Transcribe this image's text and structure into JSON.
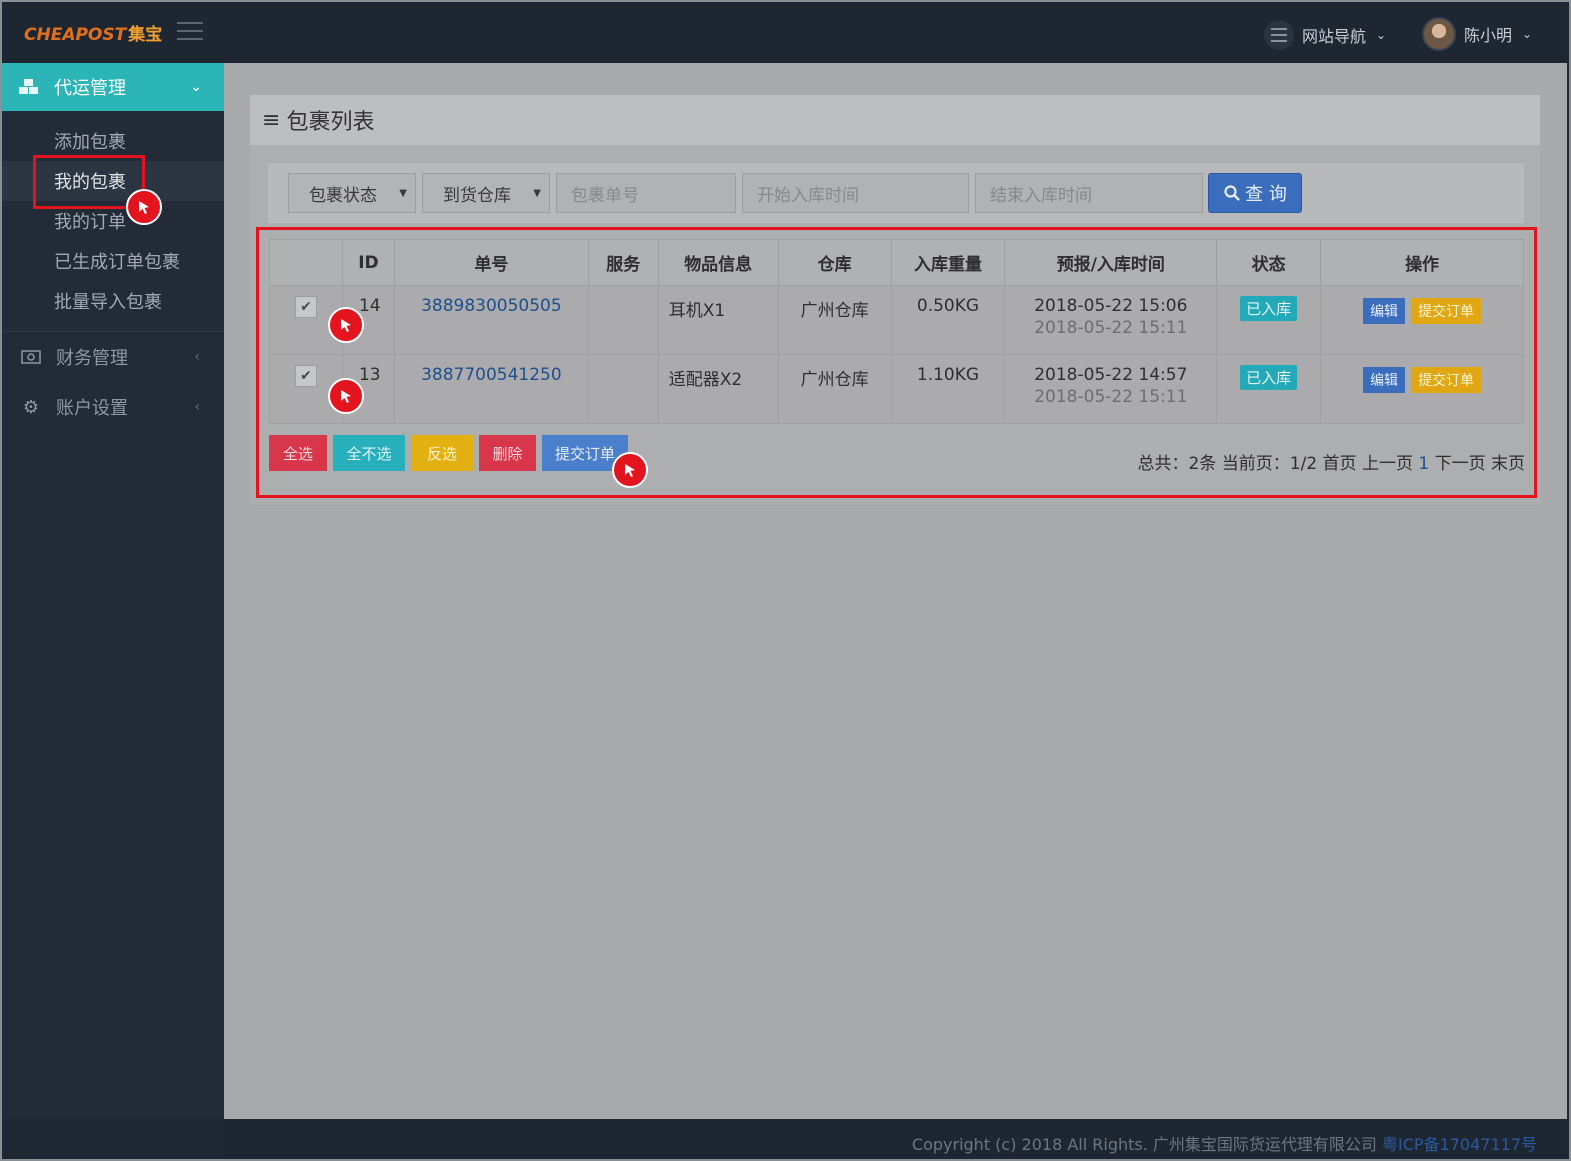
{
  "header": {
    "logo_en": "CHEAPOST",
    "logo_cn": "集宝",
    "nav_label": "网站导航",
    "user_name": "陈小明"
  },
  "sidebar": {
    "group_main": "代运管理",
    "items": [
      "添加包裹",
      "我的包裹",
      "我的订单",
      "已生成订单包裹",
      "批量导入包裹"
    ],
    "group_finance": "财务管理",
    "group_account": "账户设置"
  },
  "panel": {
    "title": "包裹列表"
  },
  "filters": {
    "status": "包裹状态",
    "warehouse": "到货仓库",
    "tracking_placeholder": "包裹单号",
    "start_placeholder": "开始入库时间",
    "end_placeholder": "结束入库时间",
    "search": "查 询"
  },
  "table": {
    "headers": [
      "ID",
      "单号",
      "服务",
      "物品信息",
      "仓库",
      "入库重量",
      "预报/入库时间",
      "状态",
      "操作"
    ],
    "rows": [
      {
        "id": "14",
        "no": "3889830050505",
        "service": "",
        "item": "耳机X1",
        "warehouse": "广州仓库",
        "weight": "0.50KG",
        "t1": "2018-05-22 15:06",
        "t2": "2018-05-22 15:11",
        "status": "已入库",
        "edit": "编辑",
        "submit": "提交订单"
      },
      {
        "id": "13",
        "no": "3887700541250",
        "service": "",
        "item": "适配器X2",
        "warehouse": "广州仓库",
        "weight": "1.10KG",
        "t1": "2018-05-22 14:57",
        "t2": "2018-05-22 15:11",
        "status": "已入库",
        "edit": "编辑",
        "submit": "提交订单"
      }
    ]
  },
  "actions": {
    "select_all": "全选",
    "select_none": "全不选",
    "invert": "反选",
    "delete": "删除",
    "submit": "提交订单"
  },
  "pager": {
    "total": "总共：2条",
    "current": "当前页：1/2",
    "first": "首页",
    "prev": "上一页",
    "page": "1",
    "next": "下一页",
    "last": "末页"
  },
  "footer": {
    "copyright": "Copyright (c) 2018 All Rights. 广州集宝国际货运代理有限公司",
    "icp": "粤ICP备17047117号"
  },
  "colors": {
    "accent": "#2cb5b6",
    "primary": "#3a6dbc",
    "danger": "#e3404f",
    "warning": "#f2c318",
    "info": "#3cc6cc",
    "highlight": "#e4141f"
  }
}
